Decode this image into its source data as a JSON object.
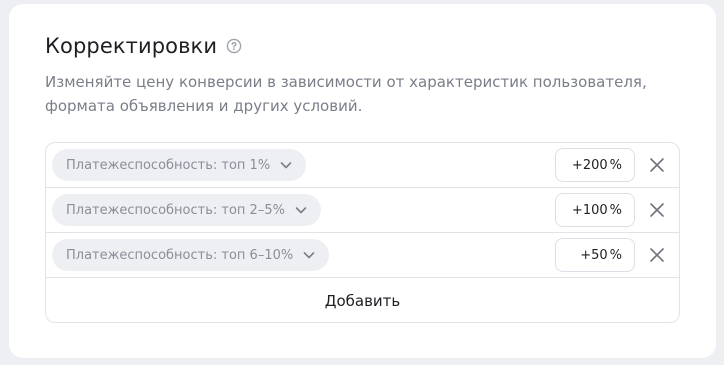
{
  "section": {
    "title": "Корректировки",
    "help_icon": "question-circle-icon",
    "description": "Изменяйте цену конверсии в зависимости от характеристик пользователя, формата объявления и других условий."
  },
  "adjustments": [
    {
      "condition": "Платежеспособность: топ 1%",
      "value": "+200",
      "unit": "%"
    },
    {
      "condition": "Платежеспособность: топ 2–5%",
      "value": "+100",
      "unit": "%"
    },
    {
      "condition": "Платежеспособность: топ 6–10%",
      "value": "+50",
      "unit": "%"
    }
  ],
  "icons": {
    "chevron": "chevron-down-icon",
    "remove": "close-icon"
  },
  "add_button_label": "Добавить",
  "colors": {
    "page_bg": "#edeff3",
    "card_bg": "#ffffff",
    "chip_bg": "#edeff3",
    "text_primary": "#1f1f23",
    "text_secondary": "#7a7e88"
  }
}
